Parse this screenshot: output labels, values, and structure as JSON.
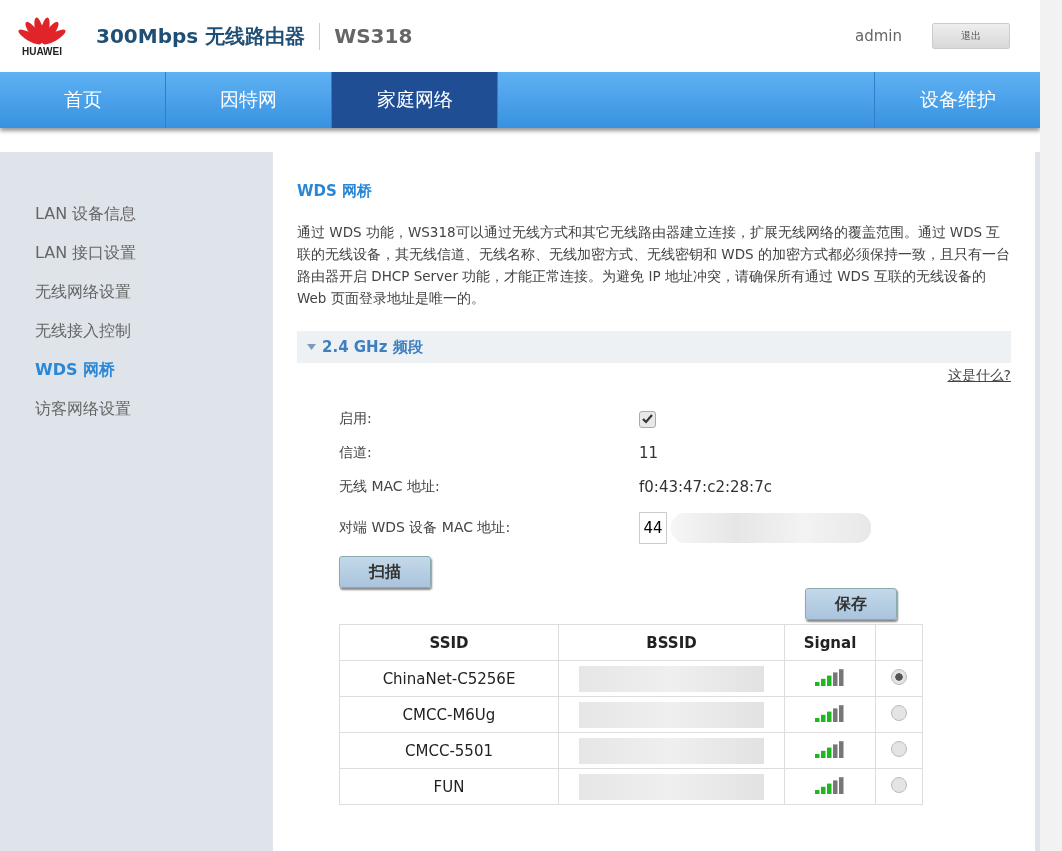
{
  "header": {
    "brand": "HUAWEI",
    "product": "300Mbps 无线路由器",
    "model": "WS318",
    "user": "admin",
    "logout": "退出"
  },
  "nav": [
    {
      "label": "首页",
      "selected": false
    },
    {
      "label": "因特网",
      "selected": false
    },
    {
      "label": "家庭网络",
      "selected": true
    },
    {
      "label": "设备维护",
      "selected": false
    }
  ],
  "sidebar": [
    {
      "label": "LAN 设备信息",
      "selected": false
    },
    {
      "label": "LAN 接口设置",
      "selected": false
    },
    {
      "label": "无线网络设置",
      "selected": false
    },
    {
      "label": "无线接入控制",
      "selected": false
    },
    {
      "label": "WDS 网桥",
      "selected": true
    },
    {
      "label": "访客网络设置",
      "selected": false
    }
  ],
  "content": {
    "title": "WDS 网桥",
    "description": "通过 WDS 功能，WS318可以通过无线方式和其它无线路由器建立连接，扩展无线网络的覆盖范围。通过 WDS 互联的无线设备，其无线信道、无线名称、无线加密方式、无线密钥和 WDS 的加密方式都必须保持一致，且只有一台路由器开启 DHCP Server 功能，才能正常连接。为避免 IP 地址冲突，请确保所有通过 WDS 互联的无线设备的 Web 页面登录地址是唯一的。",
    "section": {
      "title": "2.4 GHz 频段",
      "expanded": true
    },
    "help_link": "这是什么?",
    "enable": {
      "label": "启用:",
      "checked": true
    },
    "channel": {
      "label": "信道:",
      "value": "11"
    },
    "mac": {
      "label": "无线 MAC 地址:",
      "value": "f0:43:47:c2:28:7c"
    },
    "peer_mac": {
      "label": "对端 WDS 设备 MAC 地址:",
      "first_octet": "44"
    },
    "scan_button": "扫描",
    "save_button": "保存",
    "table": {
      "columns": [
        "SSID",
        "BSSID",
        "Signal"
      ],
      "rows": [
        {
          "ssid": "ChinaNet-C5256E",
          "selected": true
        },
        {
          "ssid": "CMCC-M6Ug",
          "selected": false
        },
        {
          "ssid": "CMCC-5501",
          "selected": false
        },
        {
          "ssid": "FUN",
          "selected": false
        }
      ]
    }
  }
}
